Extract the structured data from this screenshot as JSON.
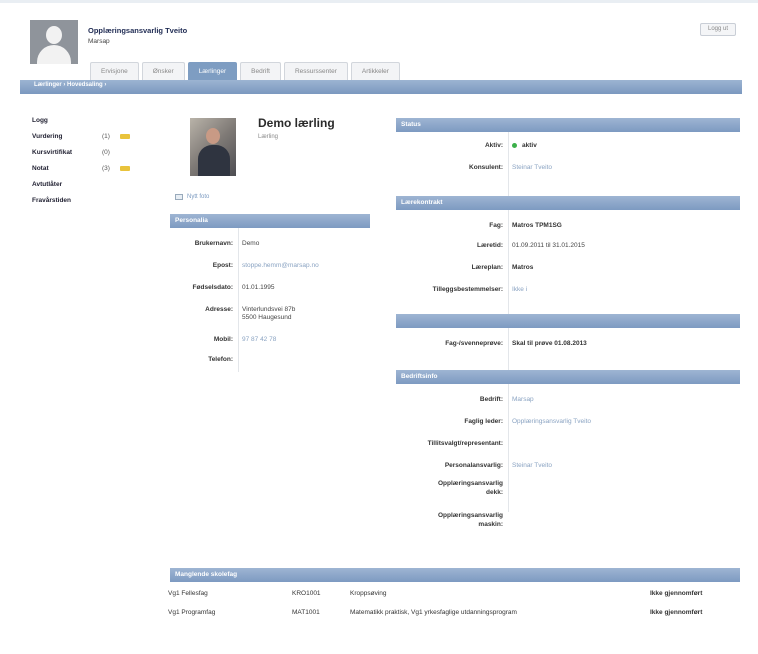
{
  "header": {
    "title": "Opplæringsansvarlig Tveito",
    "subtitle": "Marsap",
    "logout_label": "Logg ut"
  },
  "tabs": [
    {
      "label": "Ervisjone"
    },
    {
      "label": "Ønsker"
    },
    {
      "label": "Lærlinger"
    },
    {
      "label": "Bedrift"
    },
    {
      "label": "Ressurssenter"
    },
    {
      "label": "Artikkeler"
    }
  ],
  "breadcrumb": "Lærlinger  ›  Hovedsaling  ›",
  "nav": [
    {
      "label": "Logg",
      "count": ""
    },
    {
      "label": "Vurdering",
      "count": "(1)"
    },
    {
      "label": "Kursvirtifikat",
      "count": "(0)"
    },
    {
      "label": "Notat",
      "count": "(3)"
    },
    {
      "label": "Avtutlåter",
      "count": ""
    },
    {
      "label": "Fravårstiden",
      "count": ""
    }
  ],
  "profile": {
    "name": "Demo lærling",
    "role": "Lærling",
    "photo_link": "Nytt foto"
  },
  "personalia": {
    "heading": "Personalia",
    "rows": [
      {
        "k": "Brukernavn:",
        "v": "Demo"
      },
      {
        "k": "Epost:",
        "v": "stoppe.hemm@marsap.no"
      },
      {
        "k": "Fødselsdato:",
        "v": "01.01.1995"
      },
      {
        "k": "Adresse:",
        "v": "Vinterlundsvei 87b"
      },
      {
        "k": "",
        "v": "5500 Haugesund"
      },
      {
        "k": "Mobil:",
        "v": "97 87 42 78"
      },
      {
        "k": "Telefon:",
        "v": ""
      }
    ]
  },
  "status": {
    "heading": "Status",
    "active_label": "Aktiv:",
    "active_value": "aktiv",
    "consultant_label": "Konsulent:",
    "consultant_value": "Steinar Tveito"
  },
  "contract": {
    "heading": "Lærekontrakt",
    "rows": [
      {
        "k": "Fag:",
        "v": "Matros TPM1SG",
        "style": "bold"
      },
      {
        "k": "Læretid:",
        "v": "01.09.2011 til 31.01.2015",
        "style": "plain"
      },
      {
        "k": "Læreplan:",
        "v": "Matros",
        "style": "bold"
      },
      {
        "k": "Tilleggsbestemmelser:",
        "v": "Ikke  i",
        "style": "link"
      }
    ]
  },
  "exam": {
    "label": "Fag-/svenneprøve:",
    "value": "Skal til prøve 01.08.2013"
  },
  "company": {
    "heading": "Bedriftsinfo",
    "rows": [
      {
        "k": "Bedrift:",
        "v": "Marsap"
      },
      {
        "k": "Faglig leder:",
        "v": "Opplæringsansvarlig Tveito"
      },
      {
        "k": "Tillitsvalgt/representant:",
        "v": ""
      },
      {
        "k": "Personalansvarlig:",
        "v": "Steinar Tveito"
      },
      {
        "k": "Opplæringsansvarlig",
        "v": ""
      },
      {
        "k": "dekk:",
        "v": ""
      },
      {
        "k": "Opplæringsansvarlig",
        "v": ""
      },
      {
        "k": "maskin:",
        "v": ""
      }
    ]
  },
  "subjects": {
    "heading": "Manglende skolefag",
    "rows": [
      {
        "c1": "Vg1 Fellesfag",
        "c2": "KRO1001",
        "c3": "Kroppsøving",
        "c4": "Ikke gjennomført"
      },
      {
        "c1": "Vg1 Programfag",
        "c2": "MAT1001",
        "c3": "Matematikk praktisk, Vg1 yrkesfaglige utdanningsprogram",
        "c4": "Ikke gjennomført"
      }
    ]
  },
  "colors": {
    "accent": "#7e9dc2",
    "status_active": "#3bb04a",
    "warning": "#e9c33c"
  }
}
